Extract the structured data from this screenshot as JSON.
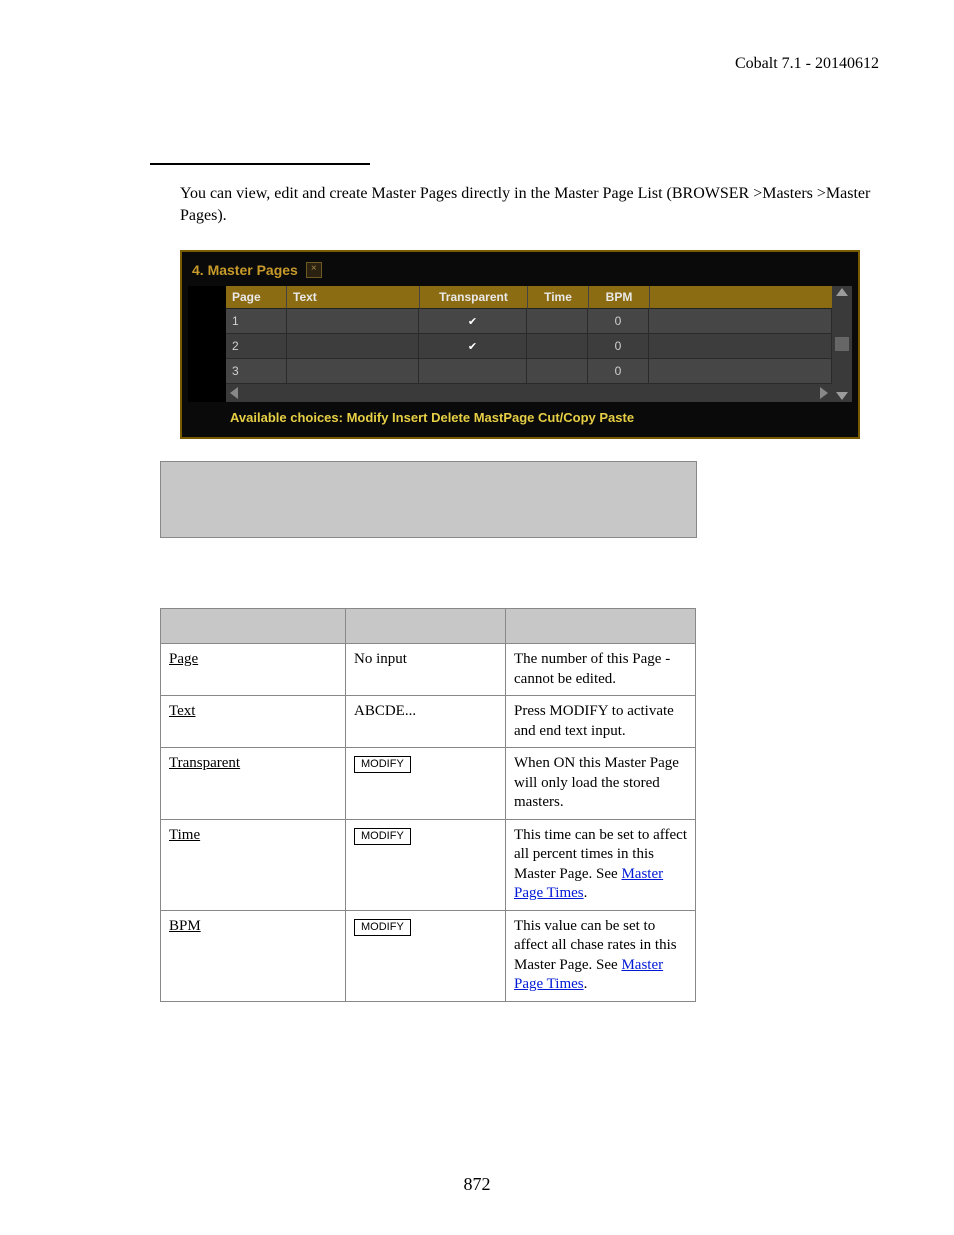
{
  "header_right": "Cobalt 7.1 - 20140612",
  "intro": "You can view, edit and create Master Pages directly in the Master Page List (BROWSER >Masters >Master Pages).",
  "panel": {
    "tab_title": "4. Master Pages",
    "headers": {
      "page": "Page",
      "text": "Text",
      "transparent": "Transparent",
      "time": "Time",
      "bpm": "BPM"
    },
    "rows": [
      {
        "page": "1",
        "text": "",
        "transparent": true,
        "time": "",
        "bpm": "0"
      },
      {
        "page": "2",
        "text": "",
        "transparent": true,
        "time": "",
        "bpm": "0"
      },
      {
        "page": "3",
        "text": "",
        "transparent": false,
        "time": "",
        "bpm": "0"
      }
    ],
    "choices": "Available choices: Modify Insert Delete MastPage Cut/Copy Paste"
  },
  "cols_table": {
    "rows": [
      {
        "col": "Page",
        "input": "No input",
        "expl": "The number of this Page - cannot be edited.",
        "link": null,
        "link2": null,
        "input_is_button": false
      },
      {
        "col": "Text",
        "input": "ABCDE...",
        "expl": "Press MODIFY to activate and end text input.",
        "link": null,
        "link2": null,
        "input_is_button": false
      },
      {
        "col": "Transparent",
        "input": "MODIFY",
        "expl": "When ON this Master Page will only load the stored masters.",
        "link": null,
        "link2": null,
        "input_is_button": true
      },
      {
        "col": "Time",
        "input": "MODIFY",
        "expl_pre": "This time can be set to affect all percent times in this Master Page. See ",
        "link": "Master Page Times",
        "expl_post": ".",
        "input_is_button": true
      },
      {
        "col": "BPM",
        "input": "MODIFY",
        "expl_pre": "This value can be set to affect all chase rates in this Master Page. See ",
        "link": "Master Page Times",
        "expl_post": ".",
        "input_is_button": true
      }
    ]
  },
  "page_number": "872"
}
